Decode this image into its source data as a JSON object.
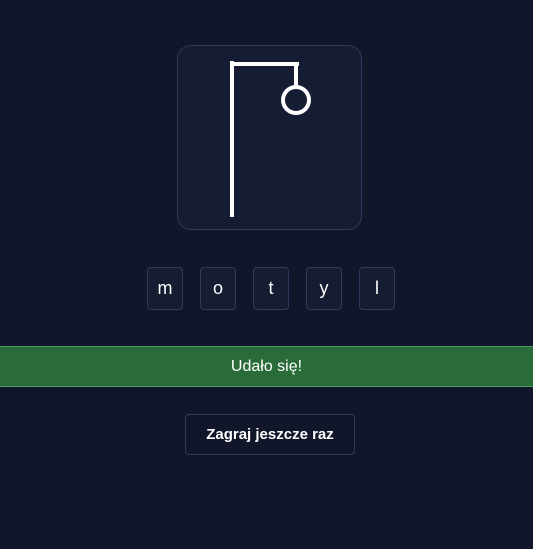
{
  "game": {
    "drawing_stage": "head",
    "letters": [
      {
        "char": "m"
      },
      {
        "char": "o"
      },
      {
        "char": "t"
      },
      {
        "char": "y"
      },
      {
        "char": "l"
      }
    ],
    "status_text": "Udało się!",
    "play_again_label": "Zagraj jeszcze raz"
  },
  "colors": {
    "background": "#12162a",
    "card": "#161c31",
    "border": "#2f3b5c",
    "success": "#2a6b3a",
    "drawing": "#ffffff"
  }
}
